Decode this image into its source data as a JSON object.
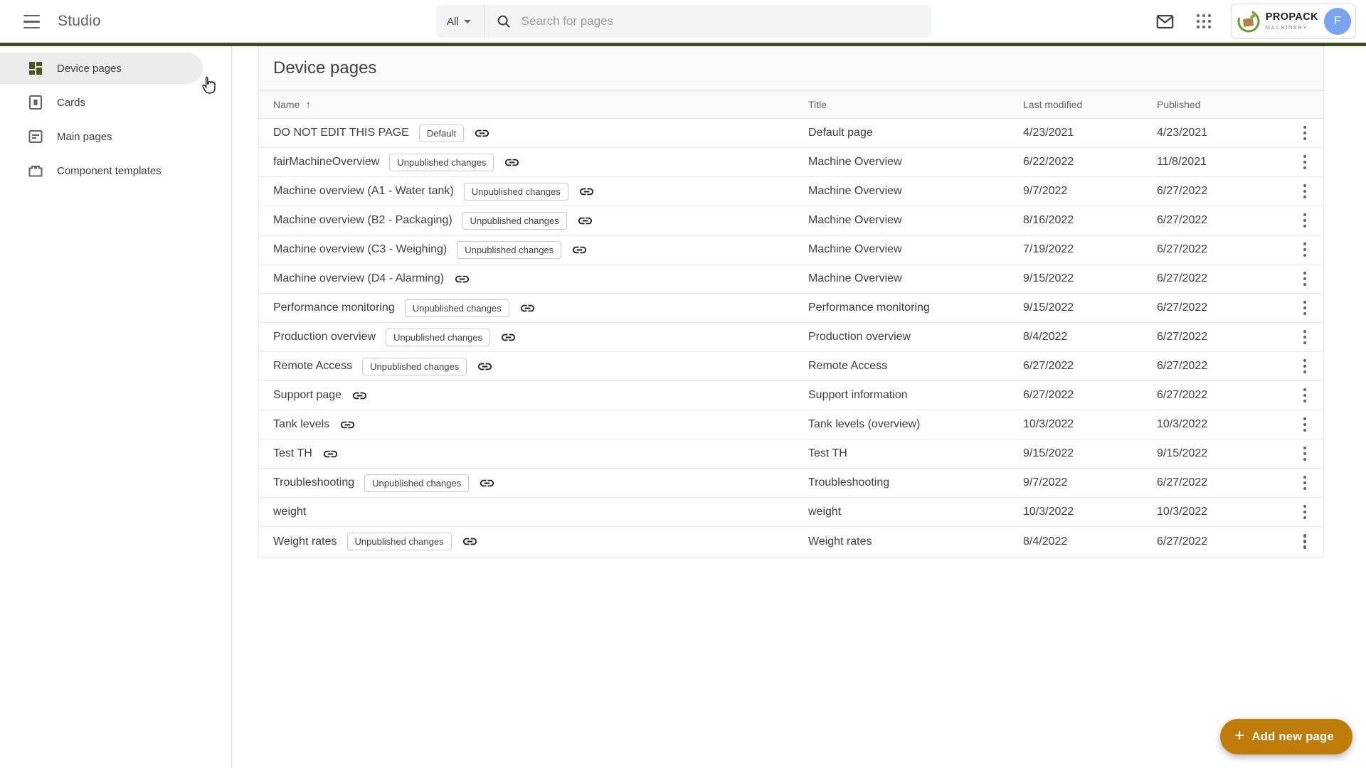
{
  "app": {
    "title": "Studio",
    "search": {
      "filter": "All",
      "placeholder": "Search for pages"
    },
    "account": {
      "brand_name": "PROPACK",
      "brand_sub": "MACHINERY",
      "avatar_initial": "F"
    }
  },
  "sidebar": {
    "items": [
      {
        "label": "Device pages",
        "icon": "dashboard-icon",
        "selected": true
      },
      {
        "label": "Cards",
        "icon": "cards-icon",
        "selected": false
      },
      {
        "label": "Main pages",
        "icon": "pages-icon",
        "selected": false
      },
      {
        "label": "Component templates",
        "icon": "templates-icon",
        "selected": false
      }
    ]
  },
  "main": {
    "title": "Device pages",
    "columns": [
      "Name",
      "Title",
      "Last modified",
      "Published"
    ],
    "sort": {
      "column": "Name",
      "direction": "asc",
      "arrow": "↑"
    },
    "rows": [
      {
        "name": "DO NOT EDIT THIS PAGE",
        "badge": "Default",
        "link": true,
        "title": "Default page",
        "modified": "4/23/2021",
        "published": "4/23/2021"
      },
      {
        "name": "fairMachineOverview",
        "badge": "Unpublished changes",
        "link": true,
        "title": "Machine Overview",
        "modified": "6/22/2022",
        "published": "11/8/2021"
      },
      {
        "name": "Machine overview (A1 - Water tank)",
        "badge": "Unpublished changes",
        "link": true,
        "title": "Machine Overview",
        "modified": "9/7/2022",
        "published": "6/27/2022"
      },
      {
        "name": "Machine overview (B2 - Packaging)",
        "badge": "Unpublished changes",
        "link": true,
        "title": "Machine Overview",
        "modified": "8/16/2022",
        "published": "6/27/2022"
      },
      {
        "name": "Machine overview (C3 - Weighing)",
        "badge": "Unpublished changes",
        "link": true,
        "title": "Machine Overview",
        "modified": "7/19/2022",
        "published": "6/27/2022"
      },
      {
        "name": "Machine overview (D4 - Alarming)",
        "badge": null,
        "link": true,
        "title": "Machine Overview",
        "modified": "9/15/2022",
        "published": "6/27/2022"
      },
      {
        "name": "Performance monitoring",
        "badge": "Unpublished changes",
        "link": true,
        "title": "Performance monitoring",
        "modified": "9/15/2022",
        "published": "6/27/2022"
      },
      {
        "name": "Production overview",
        "badge": "Unpublished changes",
        "link": true,
        "title": "Production overview",
        "modified": "8/4/2022",
        "published": "6/27/2022"
      },
      {
        "name": "Remote Access",
        "badge": "Unpublished changes",
        "link": true,
        "title": "Remote Access",
        "modified": "6/27/2022",
        "published": "6/27/2022"
      },
      {
        "name": "Support page",
        "badge": null,
        "link": true,
        "title": "Support information",
        "modified": "6/27/2022",
        "published": "6/27/2022"
      },
      {
        "name": "Tank levels",
        "badge": null,
        "link": true,
        "title": "Tank levels (overview)",
        "modified": "10/3/2022",
        "published": "10/3/2022"
      },
      {
        "name": "Test TH",
        "badge": null,
        "link": true,
        "title": "Test TH",
        "modified": "9/15/2022",
        "published": "9/15/2022"
      },
      {
        "name": "Troubleshooting",
        "badge": "Unpublished changes",
        "link": true,
        "title": "Troubleshooting",
        "modified": "9/7/2022",
        "published": "6/27/2022"
      },
      {
        "name": "weight",
        "badge": null,
        "link": false,
        "title": "weight",
        "modified": "10/3/2022",
        "published": "10/3/2022"
      },
      {
        "name": "Weight rates",
        "badge": "Unpublished changes",
        "link": true,
        "title": "Weight rates",
        "modified": "8/4/2022",
        "published": "6/27/2022"
      }
    ]
  },
  "fab": {
    "label": "Add new page"
  },
  "colors": {
    "brand_divider": "#3f4a1e",
    "selected_icon": "#4b551f",
    "fab": "#bf7c09",
    "avatar": "#7aa3f0",
    "selected_pill": "#ececec"
  }
}
